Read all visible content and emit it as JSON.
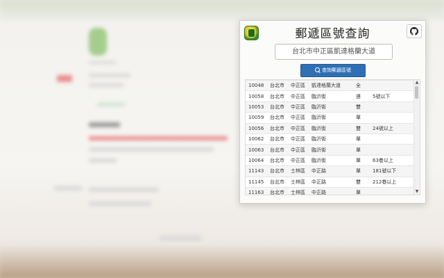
{
  "popup": {
    "title": "郵遞區號查詢",
    "search": {
      "value": "台北市中正區凱達格蘭大道",
      "placeholder": ""
    },
    "query_button": "查詢郵遞區號",
    "icons": {
      "app": "post-office-icon",
      "github": "github-icon",
      "search": "search-icon"
    },
    "colors": {
      "button": "#2f6fb4"
    },
    "rows": [
      [
        "10048",
        "台北市",
        "中正區",
        "凱達格蘭大道",
        "全",
        ""
      ],
      [
        "10058",
        "台北市",
        "中正區",
        "臨沂街",
        "連",
        "5號以下"
      ],
      [
        "10053",
        "台北市",
        "中正區",
        "臨沂街",
        "雙",
        ""
      ],
      [
        "10059",
        "台北市",
        "中正區",
        "臨沂街",
        "單",
        ""
      ],
      [
        "10056",
        "台北市",
        "中正區",
        "臨沂街",
        "雙",
        "24號以上"
      ],
      [
        "10062",
        "台北市",
        "中正區",
        "臨沂街",
        "單",
        ""
      ],
      [
        "10063",
        "台北市",
        "中正區",
        "臨沂街",
        "單",
        ""
      ],
      [
        "10064",
        "台北市",
        "中正區",
        "臨沂街",
        "單",
        "63巷以上"
      ],
      [
        "11143",
        "台北市",
        "士林區",
        "中正路",
        "單",
        "181號以下"
      ],
      [
        "11145",
        "台北市",
        "士林區",
        "中正路",
        "雙",
        "212巷以上"
      ],
      [
        "11163",
        "台北市",
        "士林區",
        "中正路",
        "單",
        ""
      ]
    ]
  }
}
